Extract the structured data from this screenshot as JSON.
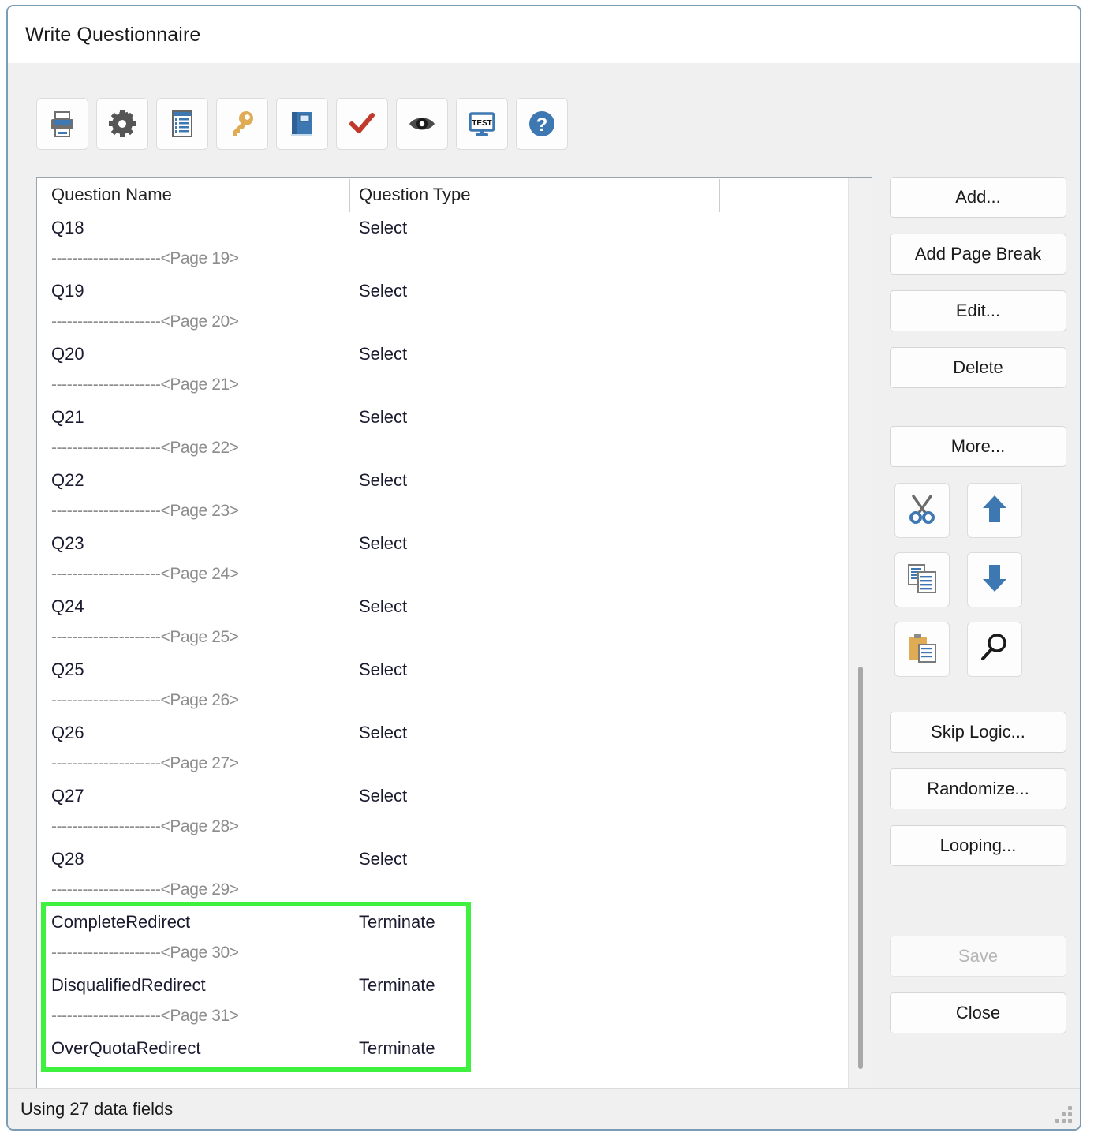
{
  "window": {
    "title": "Write Questionnaire"
  },
  "toolbar": {
    "buttons": [
      {
        "name": "print-icon",
        "label": "Print"
      },
      {
        "name": "settings-icon",
        "label": "Settings"
      },
      {
        "name": "list-icon",
        "label": "Question List"
      },
      {
        "name": "key-icon",
        "label": "Key"
      },
      {
        "name": "book-icon",
        "label": "Library"
      },
      {
        "name": "check-icon",
        "label": "Validate"
      },
      {
        "name": "eye-icon",
        "label": "Preview"
      },
      {
        "name": "test-monitor-icon",
        "label": "Test"
      },
      {
        "name": "help-icon",
        "label": "Help"
      }
    ]
  },
  "list": {
    "columns": [
      "Question Name",
      "Question Type"
    ],
    "rows": [
      {
        "kind": "question",
        "name": "Q18",
        "type": "Select"
      },
      {
        "kind": "pagebreak",
        "name": "---------------------<Page 19>",
        "type": ""
      },
      {
        "kind": "question",
        "name": "Q19",
        "type": "Select"
      },
      {
        "kind": "pagebreak",
        "name": "---------------------<Page 20>",
        "type": ""
      },
      {
        "kind": "question",
        "name": "Q20",
        "type": "Select"
      },
      {
        "kind": "pagebreak",
        "name": "---------------------<Page 21>",
        "type": ""
      },
      {
        "kind": "question",
        "name": "Q21",
        "type": "Select"
      },
      {
        "kind": "pagebreak",
        "name": "---------------------<Page 22>",
        "type": ""
      },
      {
        "kind": "question",
        "name": "Q22",
        "type": "Select"
      },
      {
        "kind": "pagebreak",
        "name": "---------------------<Page 23>",
        "type": ""
      },
      {
        "kind": "question",
        "name": "Q23",
        "type": "Select"
      },
      {
        "kind": "pagebreak",
        "name": "---------------------<Page 24>",
        "type": ""
      },
      {
        "kind": "question",
        "name": "Q24",
        "type": "Select"
      },
      {
        "kind": "pagebreak",
        "name": "---------------------<Page 25>",
        "type": ""
      },
      {
        "kind": "question",
        "name": "Q25",
        "type": "Select"
      },
      {
        "kind": "pagebreak",
        "name": "---------------------<Page 26>",
        "type": ""
      },
      {
        "kind": "question",
        "name": "Q26",
        "type": "Select"
      },
      {
        "kind": "pagebreak",
        "name": "---------------------<Page 27>",
        "type": ""
      },
      {
        "kind": "question",
        "name": "Q27",
        "type": "Select"
      },
      {
        "kind": "pagebreak",
        "name": "---------------------<Page 28>",
        "type": ""
      },
      {
        "kind": "question",
        "name": "Q28",
        "type": "Select"
      },
      {
        "kind": "pagebreak",
        "name": "---------------------<Page 29>",
        "type": ""
      },
      {
        "kind": "question",
        "name": "CompleteRedirect",
        "type": "Terminate"
      },
      {
        "kind": "pagebreak",
        "name": "---------------------<Page 30>",
        "type": ""
      },
      {
        "kind": "question",
        "name": "DisqualifiedRedirect",
        "type": "Terminate"
      },
      {
        "kind": "pagebreak",
        "name": "---------------------<Page 31>",
        "type": ""
      },
      {
        "kind": "question",
        "name": "OverQuotaRedirect",
        "type": "Terminate"
      }
    ],
    "highlight": {
      "color": "#3ff13f"
    }
  },
  "sidepanel": {
    "add_label": "Add...",
    "add_page_break_label": "Add Page Break",
    "edit_label": "Edit...",
    "delete_label": "Delete",
    "more_label": "More...",
    "skip_logic_label": "Skip Logic...",
    "randomize_label": "Randomize...",
    "looping_label": "Looping...",
    "save_label": "Save",
    "close_label": "Close",
    "icons": [
      {
        "name": "cut-icon",
        "label": "Cut"
      },
      {
        "name": "move-up-icon",
        "label": "Move Up"
      },
      {
        "name": "copy-icon",
        "label": "Copy"
      },
      {
        "name": "move-down-icon",
        "label": "Move Down"
      },
      {
        "name": "paste-icon",
        "label": "Paste"
      },
      {
        "name": "search-icon",
        "label": "Find"
      }
    ]
  },
  "statusbar": {
    "text": "Using 27 data fields"
  }
}
